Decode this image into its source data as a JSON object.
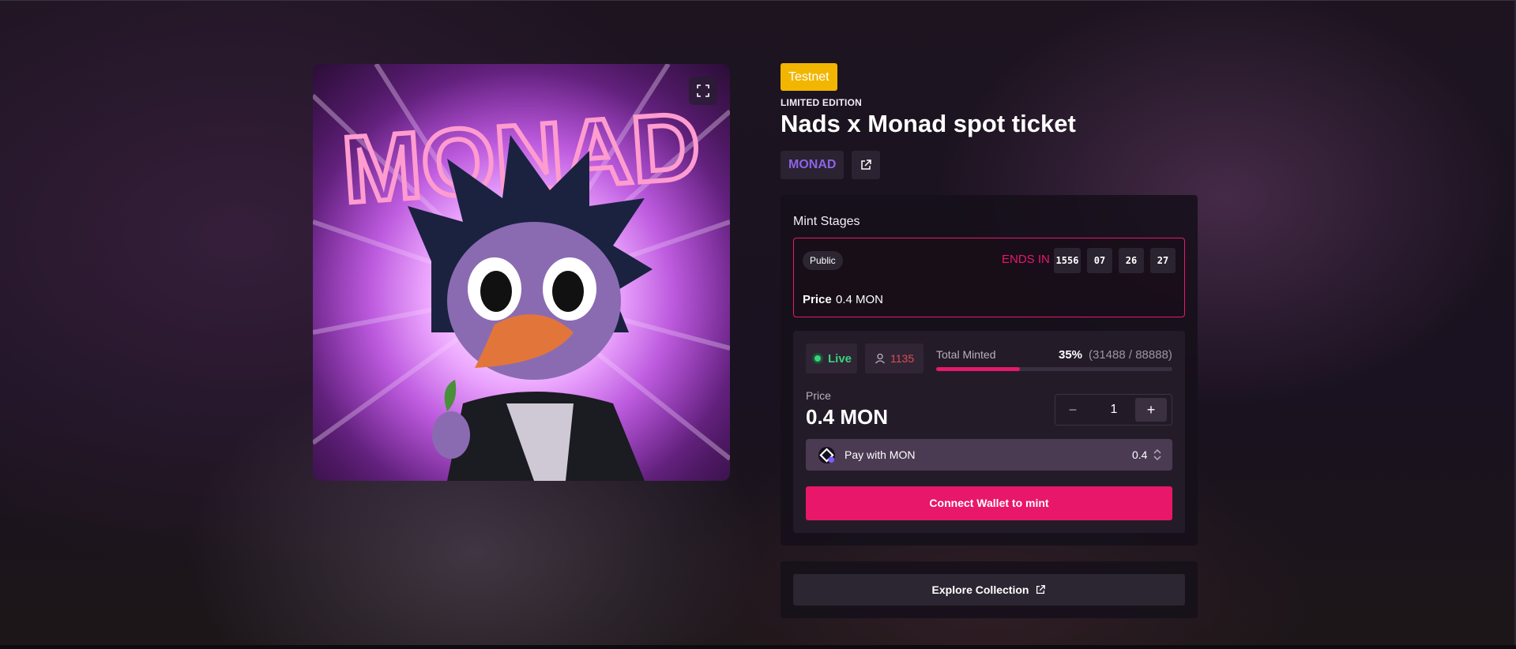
{
  "badge": "Testnet",
  "edition": "LIMITED EDITION",
  "title": "Nads x Monad spot ticket",
  "creator": "MONAD",
  "artwork": {
    "text": "MONAD"
  },
  "stages": {
    "heading": "Mint Stages",
    "stage": {
      "name": "Public",
      "ends_label": "ENDS IN",
      "countdown": [
        "1556",
        "07",
        "26",
        "27"
      ],
      "price_label": "Price",
      "price_value": "0.4 MON"
    }
  },
  "mint": {
    "status": "Live",
    "holders": "1135",
    "total_label": "Total Minted",
    "total_pct": "35%",
    "total_count": "(31488 / 88888)",
    "progress_fraction": 0.354,
    "price_label": "Price",
    "price_value": "0.4 MON",
    "quantity": "1",
    "minus": "−",
    "plus": "+",
    "pay_label": "Pay with MON",
    "pay_amount": "0.4",
    "connect_label": "Connect Wallet to mint"
  },
  "explore_label": "Explore Collection",
  "colors": {
    "accent": "#e8176a",
    "live": "#3ad17a",
    "testnet": "#f2b600",
    "creator": "#8c63e6"
  }
}
